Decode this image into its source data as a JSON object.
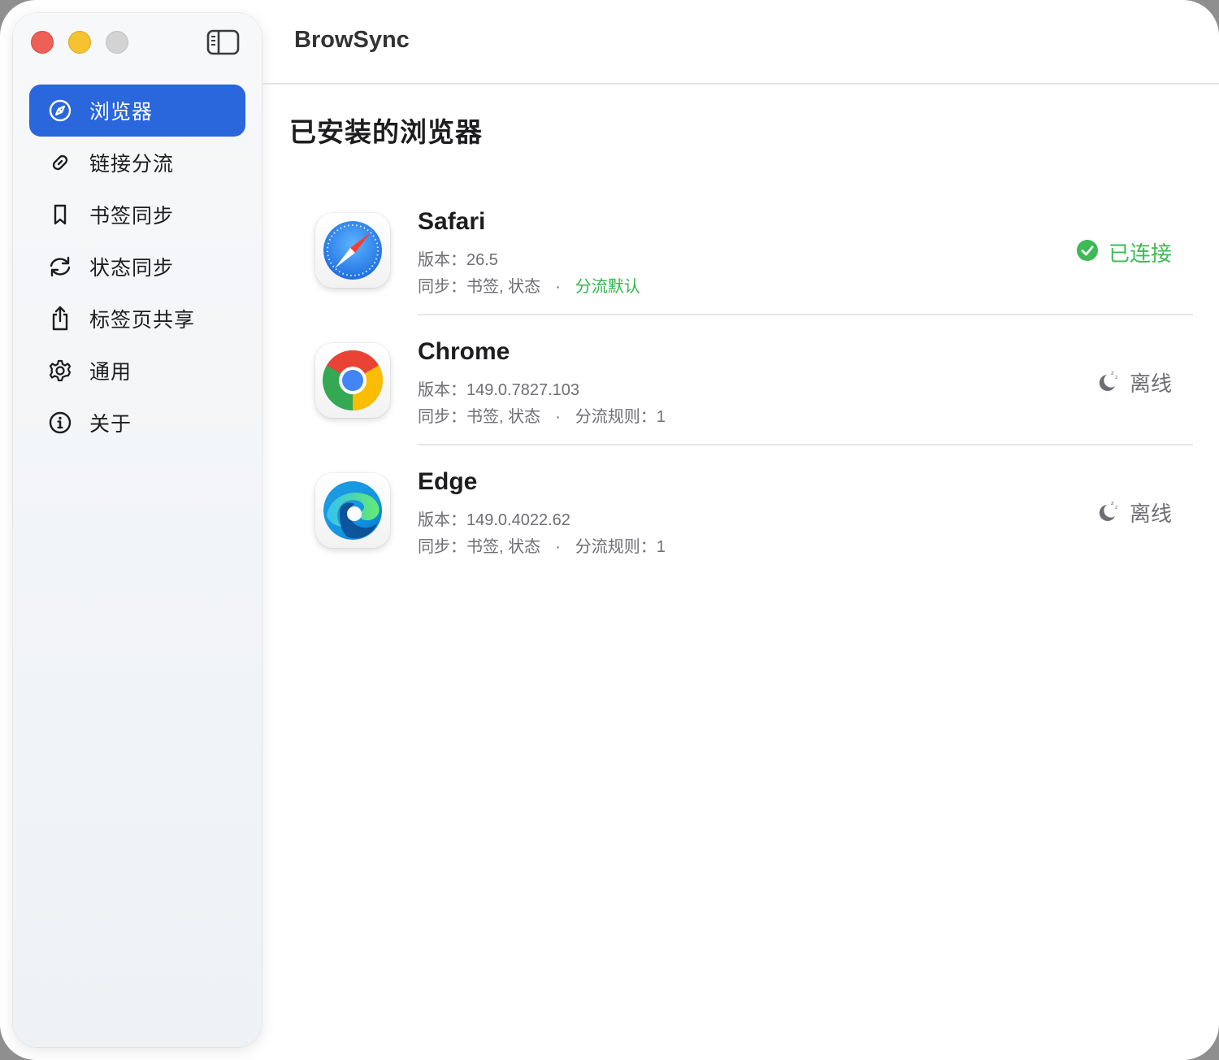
{
  "app": {
    "title": "BrowSync"
  },
  "sidebar": {
    "items": [
      {
        "label": "浏览器",
        "icon": "compass-icon",
        "active": true
      },
      {
        "label": "链接分流",
        "icon": "link-icon",
        "active": false
      },
      {
        "label": "书签同步",
        "icon": "bookmark-icon",
        "active": false
      },
      {
        "label": "状态同步",
        "icon": "sync-icon",
        "active": false
      },
      {
        "label": "标签页共享",
        "icon": "share-icon",
        "active": false
      },
      {
        "label": "通用",
        "icon": "gear-icon",
        "active": false
      },
      {
        "label": "关于",
        "icon": "info-icon",
        "active": false
      }
    ]
  },
  "main": {
    "section_title": "已安装的浏览器",
    "browsers": [
      {
        "name": "Safari",
        "version": "版本：26.5",
        "sync": "同步：书签, 状态",
        "separator": "·",
        "rule": "分流默认",
        "status": "已连接",
        "status_icon": "check-circle-icon"
      },
      {
        "name": "Chrome",
        "version": "版本：149.0.7827.103",
        "sync": "同步：书签, 状态",
        "separator": "·",
        "rule": "分流规则：1",
        "status": "离线",
        "status_icon": "moon-sleep-icon"
      },
      {
        "name": "Edge",
        "version": "版本：149.0.4022.62",
        "sync": "同步：书签, 状态",
        "separator": "·",
        "rule": "分流规则：1",
        "status": "离线",
        "status_icon": "moon-sleep-icon"
      }
    ]
  },
  "colors": {
    "accent": "#2a66dc",
    "connected": "#3dba55",
    "muted": "#6e6e73"
  }
}
